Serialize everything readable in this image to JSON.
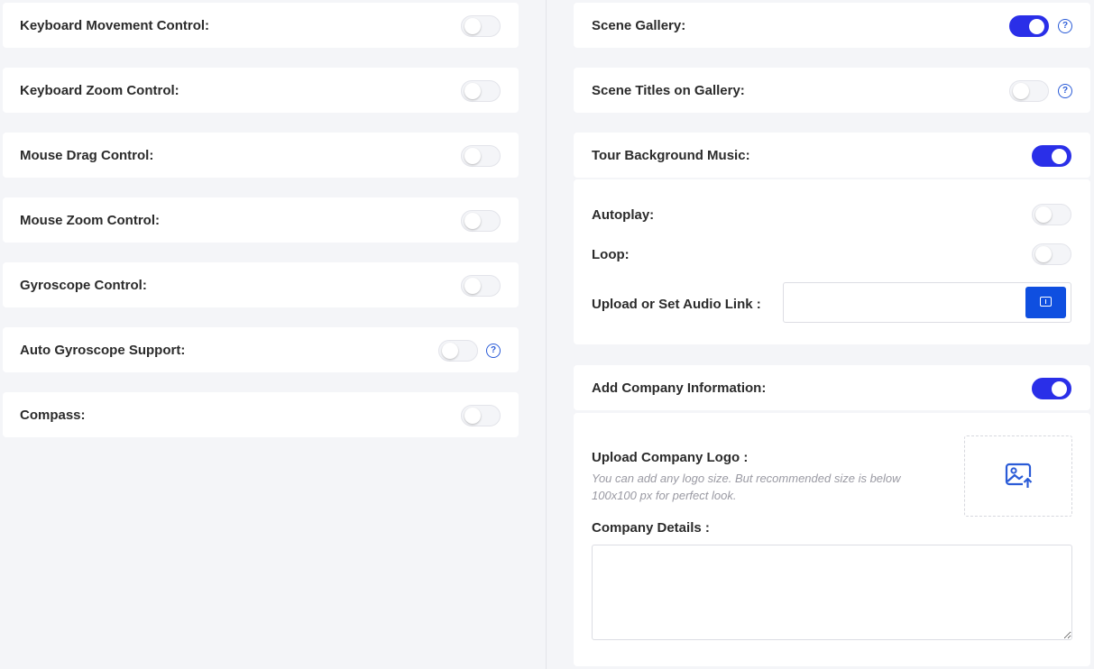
{
  "left_settings": [
    {
      "label": "Keyboard Movement Control:",
      "enabled": false
    },
    {
      "label": "Keyboard Zoom Control:",
      "enabled": false
    },
    {
      "label": "Mouse Drag Control:",
      "enabled": false
    },
    {
      "label": "Mouse Zoom Control:",
      "enabled": false
    },
    {
      "label": "Gyroscope Control:",
      "enabled": false
    },
    {
      "label": "Auto Gyroscope Support:",
      "enabled": false,
      "help_icon": "?"
    },
    {
      "label": "Compass:",
      "enabled": false
    }
  ],
  "right": {
    "scene_gallery": {
      "label": "Scene Gallery:",
      "enabled": true,
      "help_icon": "?"
    },
    "scene_titles": {
      "label": "Scene Titles on Gallery:",
      "enabled": false,
      "help_icon": "?"
    },
    "background_music": {
      "label": "Tour Background Music:",
      "enabled": true,
      "autoplay": {
        "label": "Autoplay:",
        "enabled": false
      },
      "loop": {
        "label": "Loop:",
        "enabled": false
      },
      "audio_link": {
        "label": "Upload or Set Audio Link :",
        "value": "",
        "upload_icon": "upload-icon"
      }
    },
    "company_info": {
      "label": "Add Company Information:",
      "enabled": true,
      "logo": {
        "label": "Upload Company Logo :",
        "hint_line1": "You can add any logo size. But recommended size is below",
        "hint_line2": "100x100 px for perfect look.",
        "icon": "image-upload-icon"
      },
      "details": {
        "label": "Company Details :",
        "value": ""
      }
    }
  },
  "colors": {
    "accent": "#2a2fe8",
    "help": "#2a5bd7",
    "upload_button": "#0f4fe0",
    "background": "#f4f5f8"
  }
}
